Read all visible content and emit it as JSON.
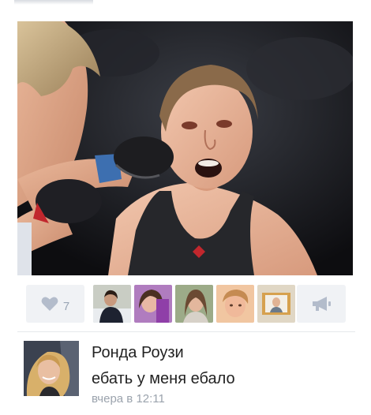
{
  "post": {
    "photo_icon": "fight-photo",
    "likes": {
      "icon": "heart-icon",
      "count": "7"
    },
    "likers_count_shown": 5,
    "share_icon": "megaphone-icon"
  },
  "comment": {
    "avatar_icon": "avatar",
    "author": "Ронда Роузи",
    "text": "ебать у меня ебало",
    "time": "вчера в 12:11"
  },
  "colors": {
    "button_bg": "#f0f2f5",
    "icon_gray": "#b3bccb",
    "meta_text": "#9ba3ad",
    "text": "#222222"
  }
}
